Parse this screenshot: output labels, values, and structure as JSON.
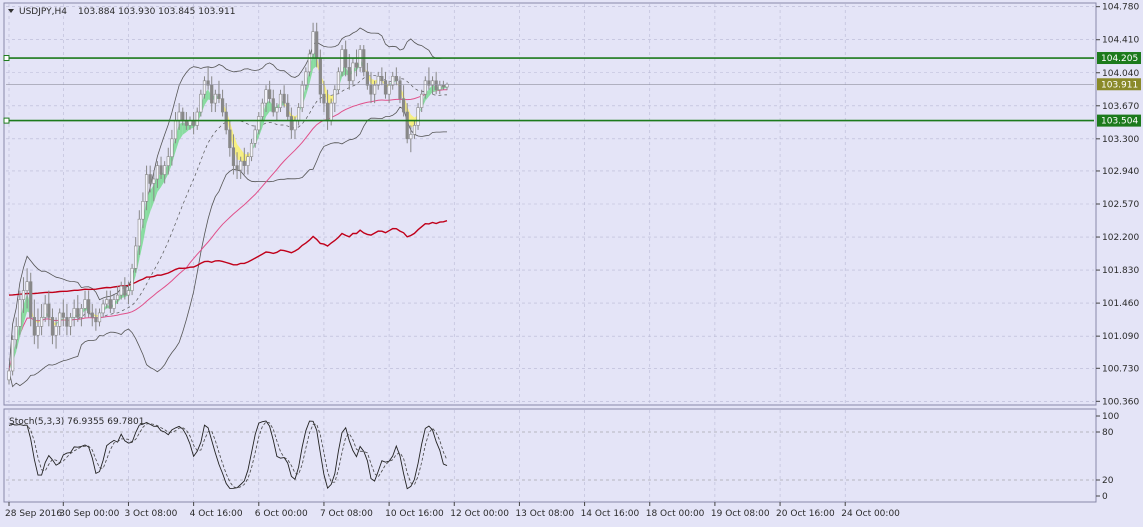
{
  "header": {
    "collapse_icon": "triangle-down-icon",
    "symbol": "USDJPY,H4",
    "quotes": "103.884 103.930 103.845 103.911"
  },
  "subwindow": {
    "indicator": "Stoch(5,3,3) 76.9355 69.7801"
  },
  "colors": {
    "background": "#e4e4f7",
    "grid": "#b8b8d4",
    "horizontal_line": "#1c7a1c",
    "ma_long": "#c0001a",
    "ma_mid": "#e0508a",
    "bands": "#555555",
    "ribbon_up": "#88dca0",
    "ribbon_down": "#f7ef80",
    "candle": "#888888",
    "current_price_bg": "#8a8a2a"
  },
  "chart_data": {
    "type": "candlestick",
    "symbol": "USDJPY",
    "timeframe": "H4",
    "ohlc_current": {
      "open": 103.884,
      "high": 103.93,
      "low": 103.845,
      "close": 103.911
    },
    "price_axis_ticks": [
      "104.780",
      "104.410",
      "104.040",
      "103.670",
      "103.300",
      "102.940",
      "102.570",
      "102.200",
      "101.830",
      "101.460",
      "101.090",
      "100.730",
      "100.360"
    ],
    "price_axis_values": [
      104.78,
      104.41,
      104.04,
      103.67,
      103.3,
      102.94,
      102.57,
      102.2,
      101.83,
      101.46,
      101.09,
      100.73,
      100.36
    ],
    "ylim": [
      100.33,
      104.81
    ],
    "time_axis_ticks": [
      "28 Sep 2016",
      "30 Sep 00:00",
      "3 Oct 08:00",
      "4 Oct 16:00",
      "6 Oct 00:00",
      "7 Oct 08:00",
      "10 Oct 16:00",
      "12 Oct 00:00",
      "13 Oct 08:00",
      "14 Oct 16:00",
      "18 Oct 00:00",
      "19 Oct 08:00",
      "20 Oct 16:00",
      "24 Oct 00:00"
    ],
    "time_axis_bars": [
      0,
      15,
      33,
      51,
      69,
      87,
      105,
      123,
      141,
      159,
      177,
      195,
      213,
      231
    ],
    "horizontal_lines": [
      {
        "price": 104.205,
        "label": "104.205"
      },
      {
        "price": 103.504,
        "label": "103.504"
      }
    ],
    "current_price": {
      "price": 103.911,
      "label": "103.911"
    },
    "candles": [
      [
        100.6,
        100.72,
        100.55,
        100.7
      ],
      [
        100.7,
        101.1,
        100.65,
        101.05
      ],
      [
        101.05,
        101.3,
        100.95,
        101.2
      ],
      [
        101.2,
        101.6,
        101.1,
        101.5
      ],
      [
        101.5,
        101.75,
        101.35,
        101.6
      ],
      [
        101.6,
        101.85,
        101.4,
        101.7
      ],
      [
        101.7,
        101.8,
        101.2,
        101.3
      ],
      [
        101.3,
        101.5,
        101.0,
        101.1
      ],
      [
        101.1,
        101.4,
        100.95,
        101.2
      ],
      [
        101.2,
        101.45,
        101.1,
        101.3
      ],
      [
        101.3,
        101.55,
        101.25,
        101.45
      ],
      [
        101.45,
        101.6,
        101.2,
        101.3
      ],
      [
        101.3,
        101.4,
        101.0,
        101.1
      ],
      [
        101.1,
        101.3,
        100.95,
        101.2
      ],
      [
        101.2,
        101.4,
        101.1,
        101.35
      ],
      [
        101.35,
        101.5,
        101.2,
        101.3
      ],
      [
        101.3,
        101.45,
        101.1,
        101.2
      ],
      [
        101.2,
        101.35,
        101.1,
        101.3
      ],
      [
        101.3,
        101.5,
        101.2,
        101.4
      ],
      [
        101.4,
        101.55,
        101.25,
        101.3
      ],
      [
        101.3,
        101.45,
        101.2,
        101.4
      ],
      [
        101.4,
        101.6,
        101.3,
        101.5
      ],
      [
        101.5,
        101.6,
        101.3,
        101.35
      ],
      [
        101.35,
        101.45,
        101.2,
        101.3
      ],
      [
        101.3,
        101.4,
        101.15,
        101.25
      ],
      [
        101.25,
        101.4,
        101.2,
        101.35
      ],
      [
        101.35,
        101.5,
        101.3,
        101.45
      ],
      [
        101.45,
        101.6,
        101.4,
        101.5
      ],
      [
        101.5,
        101.6,
        101.35,
        101.4
      ],
      [
        101.4,
        101.55,
        101.35,
        101.5
      ],
      [
        101.5,
        101.65,
        101.45,
        101.55
      ],
      [
        101.55,
        101.7,
        101.5,
        101.65
      ],
      [
        101.65,
        101.75,
        101.5,
        101.55
      ],
      [
        101.55,
        101.7,
        101.45,
        101.6
      ],
      [
        101.6,
        101.9,
        101.55,
        101.85
      ],
      [
        101.85,
        102.2,
        101.8,
        102.1
      ],
      [
        102.1,
        102.5,
        102.0,
        102.4
      ],
      [
        102.4,
        102.7,
        102.3,
        102.6
      ],
      [
        102.6,
        103.0,
        102.5,
        102.9
      ],
      [
        102.9,
        103.0,
        102.7,
        102.8
      ],
      [
        102.8,
        102.95,
        102.6,
        102.85
      ],
      [
        102.85,
        103.05,
        102.75,
        103.0
      ],
      [
        103.0,
        103.1,
        102.85,
        102.9
      ],
      [
        102.9,
        103.05,
        102.8,
        103.0
      ],
      [
        103.0,
        103.2,
        102.9,
        103.1
      ],
      [
        103.1,
        103.4,
        103.0,
        103.3
      ],
      [
        103.3,
        103.6,
        103.25,
        103.5
      ],
      [
        103.5,
        103.7,
        103.4,
        103.6
      ],
      [
        103.6,
        103.65,
        103.45,
        103.5
      ],
      [
        103.5,
        103.6,
        103.4,
        103.45
      ],
      [
        103.45,
        103.55,
        103.4,
        103.5
      ],
      [
        103.5,
        103.6,
        103.35,
        103.45
      ],
      [
        103.45,
        103.65,
        103.4,
        103.6
      ],
      [
        103.6,
        103.85,
        103.55,
        103.8
      ],
      [
        103.8,
        104.0,
        103.75,
        103.95
      ],
      [
        103.95,
        104.1,
        103.85,
        103.9
      ],
      [
        103.9,
        104.0,
        103.6,
        103.7
      ],
      [
        103.7,
        103.85,
        103.6,
        103.8
      ],
      [
        103.8,
        103.95,
        103.7,
        103.75
      ],
      [
        103.75,
        103.85,
        103.55,
        103.6
      ],
      [
        103.6,
        103.7,
        103.35,
        103.4
      ],
      [
        103.4,
        103.5,
        103.1,
        103.2
      ],
      [
        103.2,
        103.35,
        102.9,
        103.0
      ],
      [
        103.0,
        103.15,
        102.85,
        102.95
      ],
      [
        102.95,
        103.1,
        102.85,
        103.05
      ],
      [
        103.05,
        103.2,
        102.9,
        103.0
      ],
      [
        103.0,
        103.15,
        102.9,
        103.1
      ],
      [
        103.1,
        103.3,
        103.05,
        103.25
      ],
      [
        103.25,
        103.45,
        103.2,
        103.4
      ],
      [
        103.4,
        103.6,
        103.35,
        103.55
      ],
      [
        103.55,
        103.75,
        103.5,
        103.7
      ],
      [
        103.7,
        103.9,
        103.6,
        103.85
      ],
      [
        103.85,
        103.95,
        103.7,
        103.75
      ],
      [
        103.75,
        103.85,
        103.55,
        103.6
      ],
      [
        103.6,
        103.7,
        103.5,
        103.65
      ],
      [
        103.65,
        103.85,
        103.6,
        103.8
      ],
      [
        103.8,
        103.9,
        103.65,
        103.7
      ],
      [
        103.7,
        103.8,
        103.5,
        103.55
      ],
      [
        103.55,
        103.65,
        103.3,
        103.4
      ],
      [
        103.4,
        103.55,
        103.3,
        103.5
      ],
      [
        103.5,
        103.7,
        103.45,
        103.65
      ],
      [
        103.65,
        103.95,
        103.6,
        103.9
      ],
      [
        103.9,
        104.1,
        103.85,
        104.05
      ],
      [
        104.05,
        104.3,
        104.0,
        104.25
      ],
      [
        104.25,
        104.6,
        104.2,
        104.5
      ],
      [
        104.5,
        104.6,
        104.1,
        104.2
      ],
      [
        104.2,
        104.3,
        103.7,
        103.8
      ],
      [
        103.8,
        103.95,
        103.6,
        103.7
      ],
      [
        103.7,
        103.85,
        103.4,
        103.5
      ],
      [
        103.5,
        103.75,
        103.45,
        103.7
      ],
      [
        103.7,
        103.9,
        103.6,
        103.85
      ],
      [
        103.85,
        104.1,
        103.8,
        104.05
      ],
      [
        104.05,
        104.35,
        104.0,
        104.3
      ],
      [
        104.3,
        104.4,
        104.0,
        104.1
      ],
      [
        104.1,
        104.25,
        103.85,
        103.95
      ],
      [
        103.95,
        104.2,
        103.9,
        104.15
      ],
      [
        104.15,
        104.3,
        104.0,
        104.1
      ],
      [
        104.1,
        104.35,
        104.05,
        104.3
      ],
      [
        104.3,
        104.35,
        104.0,
        104.05
      ],
      [
        104.05,
        104.15,
        103.85,
        103.9
      ],
      [
        103.9,
        104.05,
        103.7,
        103.8
      ],
      [
        103.8,
        103.95,
        103.7,
        103.9
      ],
      [
        103.9,
        104.05,
        103.85,
        104.0
      ],
      [
        104.0,
        104.1,
        103.9,
        103.95
      ],
      [
        103.95,
        104.05,
        103.75,
        103.8
      ],
      [
        103.8,
        103.95,
        103.7,
        103.9
      ],
      [
        103.9,
        104.05,
        103.85,
        104.0
      ],
      [
        104.0,
        104.1,
        103.9,
        103.95
      ],
      [
        103.95,
        104.0,
        103.7,
        103.75
      ],
      [
        103.75,
        103.9,
        103.55,
        103.6
      ],
      [
        103.6,
        103.7,
        103.25,
        103.3
      ],
      [
        103.3,
        103.45,
        103.15,
        103.35
      ],
      [
        103.35,
        103.5,
        103.3,
        103.45
      ],
      [
        103.45,
        103.7,
        103.4,
        103.65
      ],
      [
        103.65,
        103.85,
        103.6,
        103.8
      ],
      [
        103.8,
        104.0,
        103.75,
        103.95
      ],
      [
        103.95,
        104.1,
        103.85,
        103.9
      ],
      [
        103.9,
        104.0,
        103.8,
        103.95
      ],
      [
        103.95,
        104.05,
        103.8,
        103.85
      ],
      [
        103.85,
        103.95,
        103.8,
        103.9
      ],
      [
        103.9,
        103.95,
        103.85,
        103.88
      ],
      [
        103.88,
        103.93,
        103.845,
        103.911
      ]
    ]
  }
}
